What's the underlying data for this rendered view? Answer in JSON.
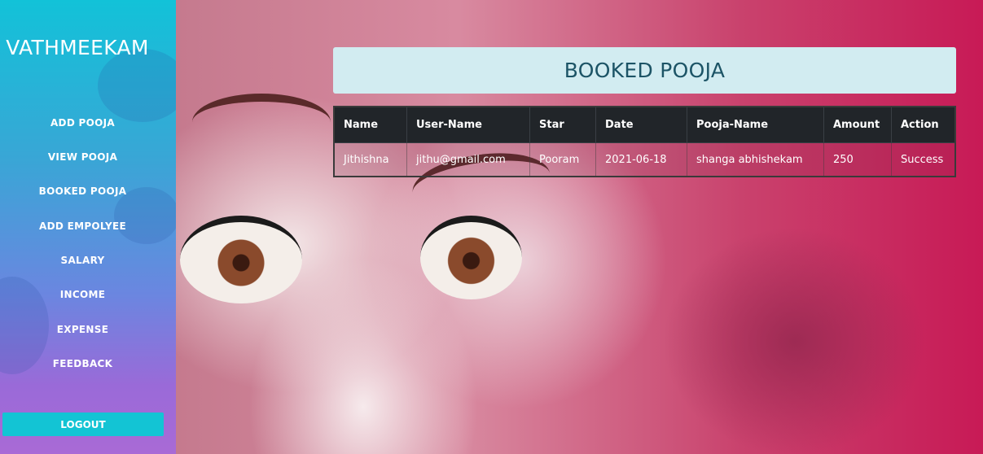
{
  "app": {
    "brand": "VATHMEEKAM"
  },
  "nav": {
    "items": [
      {
        "label": "ADD POOJA"
      },
      {
        "label": "VIEW POOJA"
      },
      {
        "label": "BOOKED POOJA"
      },
      {
        "label": "ADD EMPOLYEE"
      },
      {
        "label": "SALARY"
      },
      {
        "label": "INCOME"
      },
      {
        "label": "EXPENSE"
      },
      {
        "label": "FEEDBACK"
      }
    ],
    "logout": "LOGOUT"
  },
  "page": {
    "title": "BOOKED POOJA"
  },
  "table": {
    "headers": [
      "Name",
      "User-Name",
      "Star",
      "Date",
      "Pooja-Name",
      "Amount",
      "Action"
    ],
    "rows": [
      [
        "Jithishna",
        "jithu@gmail.com",
        "Pooram",
        "2021-06-18",
        "shanga abhishekam",
        "250",
        "Success"
      ]
    ]
  },
  "colors": {
    "sidebar_top": "#12c2d8",
    "sidebar_bottom": "#a96ad6",
    "logout_bg": "#13c4d4",
    "header_bg": "#d2ecf1",
    "header_text": "#1c5466",
    "table_header_bg": "#212529"
  }
}
